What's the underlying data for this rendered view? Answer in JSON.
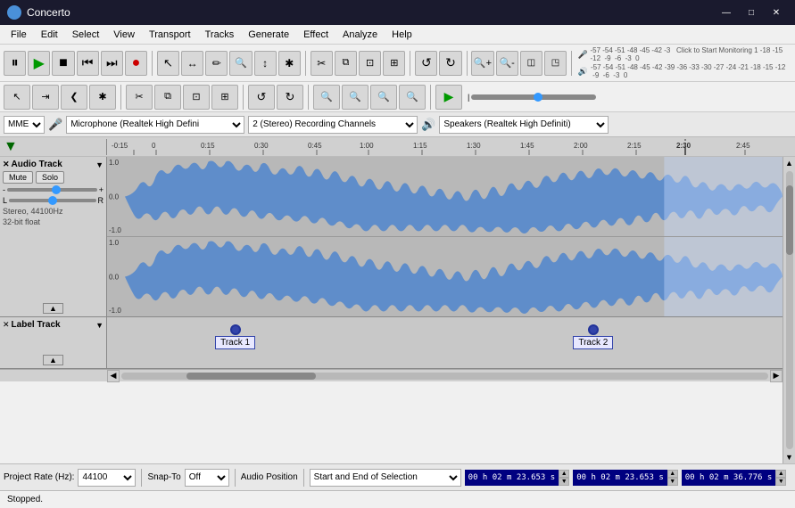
{
  "titlebar": {
    "icon": "●",
    "title": "Concerto",
    "minimize": "—",
    "maximize": "□",
    "close": "✕"
  },
  "menubar": {
    "items": [
      "File",
      "Edit",
      "Select",
      "View",
      "Transport",
      "Tracks",
      "Generate",
      "Effect",
      "Analyze",
      "Help"
    ]
  },
  "toolbar": {
    "playback": {
      "pause": "⏸",
      "play": "▶",
      "stop": "■",
      "rewind": "⏮",
      "forward": "⏭",
      "record": "●"
    },
    "tools": [
      "↖",
      "↔",
      "✏",
      "🔊",
      "↕",
      "✱"
    ],
    "edit": [
      "✂",
      "⧉",
      "⊡",
      "⊞"
    ],
    "zoom": [
      "🔍−",
      "🔍+",
      "◫",
      "◳"
    ],
    "undo": "↺",
    "redo": "↻"
  },
  "vu_meter": {
    "labels": [
      "-57",
      "-54",
      "-51",
      "-48",
      "-45",
      "-42",
      "-3",
      "Click to Start Monitoring",
      "1",
      "-18",
      "-15",
      "-12",
      "-9",
      "-6",
      "-3",
      "0"
    ],
    "labels2": [
      "-57",
      "-54",
      "-51",
      "-48",
      "-45",
      "-42",
      "-39",
      "-36",
      "-33",
      "-30",
      "-27",
      "-24",
      "-21",
      "-18",
      "-15",
      "-12",
      "-9",
      "-6",
      "-3",
      "0"
    ],
    "click_label": "Click to Start Monitoring"
  },
  "devices": {
    "audio_host": "MME",
    "microphone": "Microphone (Realtek High Defini",
    "channels": "2 (Stereo) Recording Channels",
    "speaker": "Speakers (Realtek High Definiti)"
  },
  "ruler": {
    "ticks": [
      {
        "label": "-0:15",
        "pos": 5
      },
      {
        "label": "0",
        "pos": 10
      },
      {
        "label": "0:15",
        "pos": 17
      },
      {
        "label": "0:30",
        "pos": 24
      },
      {
        "label": "0:45",
        "pos": 31
      },
      {
        "label": "1:00",
        "pos": 38
      },
      {
        "label": "1:15",
        "pos": 45
      },
      {
        "label": "1:30",
        "pos": 52
      },
      {
        "label": "1:45",
        "pos": 59
      },
      {
        "label": "2:00",
        "pos": 66
      },
      {
        "label": "2:15",
        "pos": 73
      },
      {
        "label": "2:30",
        "pos": 80
      },
      {
        "label": "2:45",
        "pos": 87
      }
    ]
  },
  "tracks": {
    "audio_track": {
      "title": "Audio Track",
      "close": "✕",
      "dropdown": "▼",
      "mute_label": "Mute",
      "solo_label": "Solo",
      "gain_min": "-",
      "gain_max": "+",
      "pan_left": "L",
      "pan_right": "R",
      "info": "Stereo, 44100Hz\n32-bit float",
      "expand": "▲",
      "y_labels_top": [
        "1.0",
        "0.0",
        "-1.0"
      ],
      "y_labels_bottom": [
        "1.0",
        "0.0",
        "-1.0"
      ]
    },
    "label_track": {
      "title": "Label Track",
      "close": "✕",
      "dropdown": "▼",
      "expand": "▲",
      "labels": [
        {
          "text": "Track 1",
          "left_pct": 16
        },
        {
          "text": "Track 2",
          "left_pct": 69
        }
      ]
    }
  },
  "bottom_toolbar": {
    "project_rate_label": "Project Rate (Hz):",
    "project_rate": "44100",
    "snap_to_label": "Snap-To",
    "snap_to": "Off",
    "audio_position_label": "Audio Position",
    "selection_type": "Start and End of Selection",
    "time1": "0 0 h 0 2 m 2 3 . 6 5 3 s",
    "time2": "0 0 h 0 2 m 2 3 . 6 5 3 s",
    "time3": "0 0 h 0 2 m 3 6 . 7 7 6 s",
    "time1_display": "00 h 02 m 23.653 s",
    "time2_display": "00 h 02 m 23.653 s",
    "time3_display": "00 h 02 m 36.776 s"
  },
  "statusbar": {
    "status": "Stopped."
  },
  "colors": {
    "waveform_blue": "#5588cc",
    "waveform_dark": "#3366aa",
    "track_bg": "#b8b8b8",
    "selected_bg": "#ddeeff",
    "ruler_bg": "#d0d0d0",
    "label_bg": "#c8c8c8"
  }
}
